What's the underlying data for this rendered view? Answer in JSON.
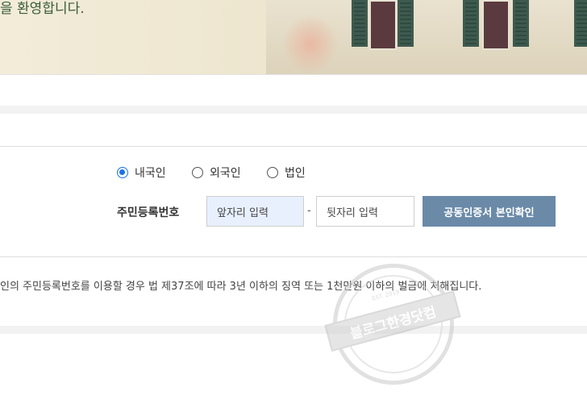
{
  "banner": {
    "text": "을 환영합니다."
  },
  "nationality": {
    "options": [
      {
        "label": "내국인",
        "selected": true
      },
      {
        "label": "외국인",
        "selected": false
      },
      {
        "label": "법인",
        "selected": false
      }
    ]
  },
  "rrn": {
    "label": "주민등록번호",
    "front_value": "앞자리 입력",
    "separator": "-",
    "back_value": "뒷자리 입력"
  },
  "cert_button": {
    "label": "공동인증서 본인확인"
  },
  "notice": {
    "text": "인의 주민등록번호를 이용할 경우 법 제37조에 따라 3년 이하의 징역 또는 1천만원 이하의 벌금에 처해집니다."
  },
  "watermark": {
    "text": "블로그한경닷컴",
    "est": "EST. 2019"
  },
  "colors": {
    "accent": "#1a73e8",
    "button": "#6a8aa8",
    "input_fill": "#e8f0fe"
  }
}
